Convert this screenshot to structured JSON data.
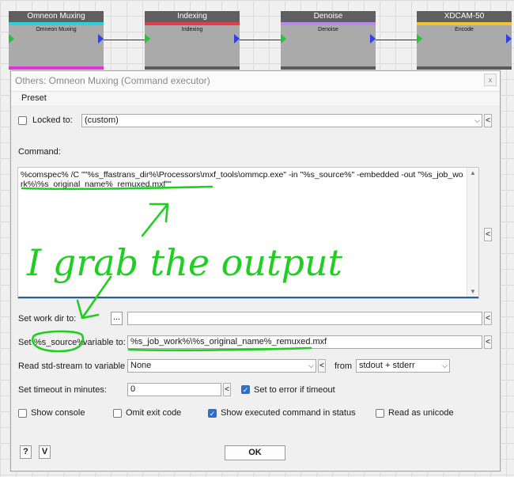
{
  "workflow": {
    "nodes": [
      {
        "title": "Omneon Muxing",
        "subtitle": "Omneon Muxing",
        "bar_color": "#29d2d8",
        "bottom_color": "#e22fd6"
      },
      {
        "title": "Indexing",
        "subtitle": "Indexing",
        "bar_color": "#e0404a",
        "bottom_color": "#5a5a5a"
      },
      {
        "title": "Denoise",
        "subtitle": "Denoise",
        "bar_color": "#b68be8",
        "bottom_color": "#5a5a5a"
      },
      {
        "title": "XDCAM-50",
        "subtitle": "Encode",
        "bar_color": "#f2c233",
        "bottom_color": "#5a5a5a"
      }
    ]
  },
  "dialog": {
    "title": "Others: Omneon Muxing (Command executor)",
    "close_label": "x",
    "menu": {
      "preset": "Preset"
    },
    "locked": {
      "label": "Locked to:",
      "value": "(custom)",
      "side": "<"
    },
    "command": {
      "label": "Command:",
      "text": "%comspec% /C \"\"%s_ffastrans_dir%\\Processors\\mxf_tools\\ommcp.exe\" -in \"%s_source%\" -embedded -out \"%s_job_work%\\%s_original_name%_remuxed.mxf\"\"",
      "side": "<"
    },
    "workdir": {
      "label": "Set work dir to:",
      "browse": "...",
      "value": "",
      "side": "<"
    },
    "setvar": {
      "prefix": "Set",
      "var": "%s_source%",
      "suffix": "variable to:",
      "value": "%s_job_work%\\%s_original_name%_remuxed.mxf",
      "side": "<"
    },
    "stdstream": {
      "label": "Read std-stream to variable",
      "value": "None",
      "side": "<",
      "from_label": "from",
      "from_value": "stdout + stderr"
    },
    "timeout": {
      "label": "Set timeout in minutes:",
      "value": "0",
      "side": "<",
      "error_label": "Set to error if timeout",
      "error_checked": true
    },
    "options": [
      {
        "label": "Show console",
        "checked": false
      },
      {
        "label": "Omit exit code",
        "checked": false
      },
      {
        "label": "Show executed command in status",
        "checked": true
      },
      {
        "label": "Read as unicode",
        "checked": false
      }
    ],
    "footer": {
      "help": "?",
      "version": "V",
      "ok": "OK"
    }
  },
  "annotation": {
    "text": "I grab the output",
    "color": "#1fcf1f"
  }
}
